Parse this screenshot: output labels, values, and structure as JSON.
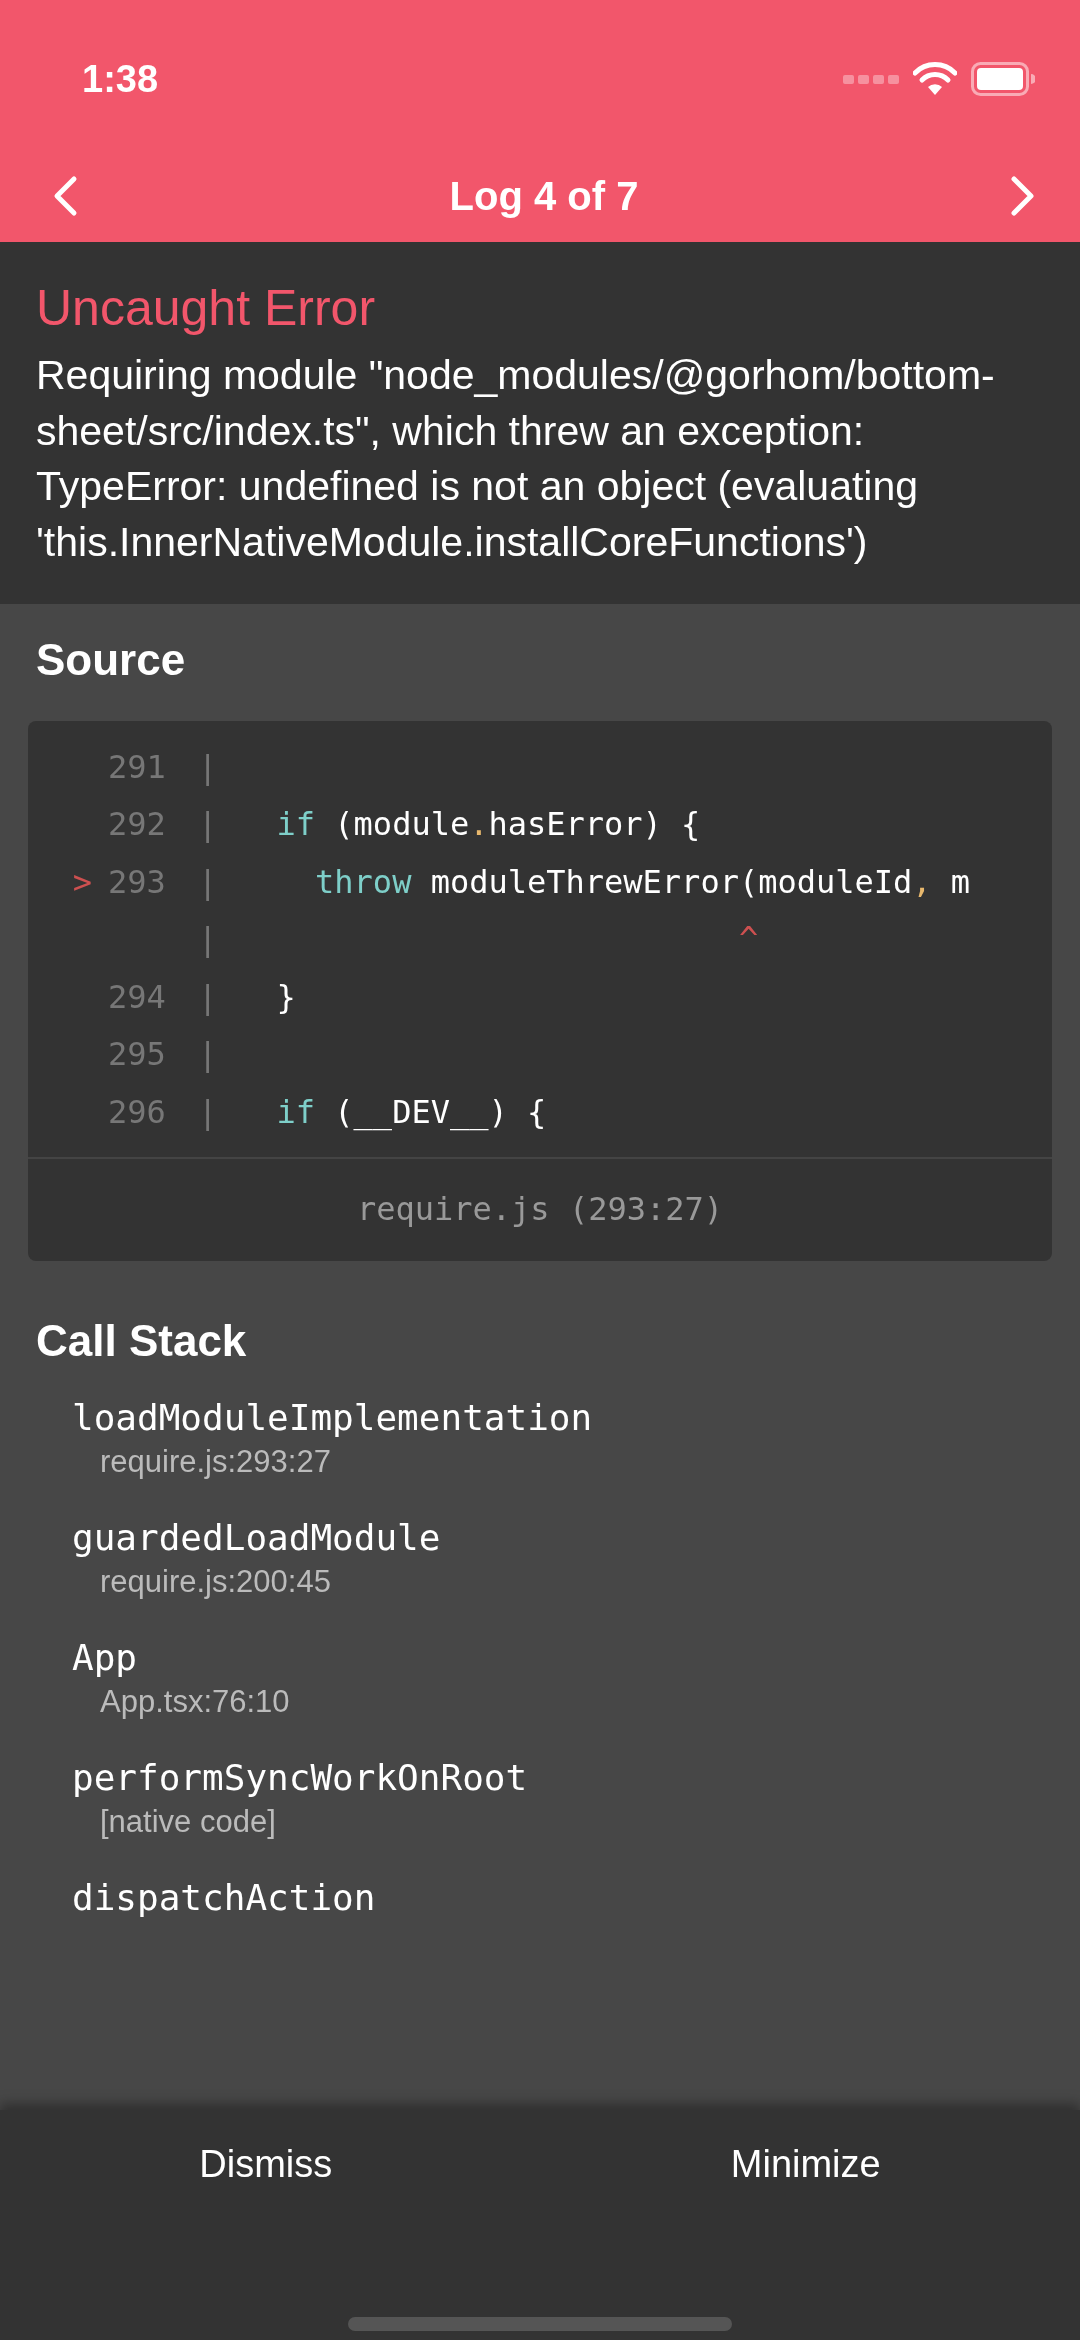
{
  "status_bar": {
    "time": "1:38"
  },
  "header": {
    "title": "Log 4 of 7"
  },
  "error": {
    "title": "Uncaught Error",
    "message": "Requiring module \"node_modules/@gorhom/bottom-sheet/src/index.ts\", which threw an exception: TypeError: undefined is not an object (evaluating 'this.InnerNativeModule.installCoreFunctions')"
  },
  "source": {
    "heading": "Source",
    "lines": [
      {
        "number": "291",
        "gutter": "|"
      },
      {
        "number": "292",
        "gutter": "|",
        "tokens": [
          {
            "kind": "keyword",
            "text": "  if"
          },
          {
            "kind": "plain",
            "text": " (module"
          },
          {
            "kind": "punct",
            "text": "."
          },
          {
            "kind": "plain",
            "text": "hasError) {"
          }
        ]
      },
      {
        "number": "293",
        "marker": ">",
        "gutter": "|",
        "tokens": [
          {
            "kind": "keyword",
            "text": "    throw"
          },
          {
            "kind": "plain",
            "text": " moduleThrewError(moduleId"
          },
          {
            "kind": "punct",
            "text": ","
          },
          {
            "kind": "plain",
            "text": " m"
          }
        ]
      },
      {
        "gutter": "|",
        "tokens": [
          {
            "kind": "caret",
            "text": "                          ^"
          }
        ]
      },
      {
        "number": "294",
        "gutter": "|",
        "tokens": [
          {
            "kind": "plain",
            "text": "  }"
          }
        ]
      },
      {
        "number": "295",
        "gutter": "|"
      },
      {
        "number": "296",
        "gutter": "|",
        "tokens": [
          {
            "kind": "keyword",
            "text": "  if"
          },
          {
            "kind": "plain",
            "text": " (__DEV__) {"
          }
        ]
      }
    ],
    "file": "require.js (293:27)"
  },
  "call_stack": {
    "heading": "Call Stack",
    "frames": [
      {
        "method": "loadModuleImplementation",
        "location": "require.js:293:27"
      },
      {
        "method": "guardedLoadModule",
        "location": "require.js:200:45"
      },
      {
        "method": "App",
        "location": "App.tsx:76:10"
      },
      {
        "method": "performSyncWorkOnRoot",
        "location": "[native code]"
      },
      {
        "method": "dispatchAction"
      }
    ]
  },
  "buttons": [
    "Dismiss",
    "Minimize"
  ]
}
